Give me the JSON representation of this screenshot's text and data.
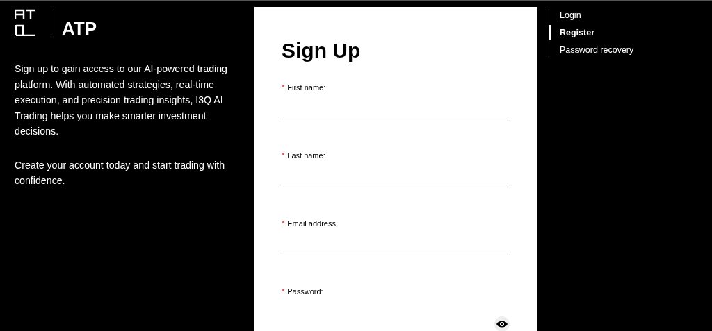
{
  "brand": {
    "name": "ATP"
  },
  "intro": [
    "Sign up to gain access to our AI-powered trading platform. With automated strategies, real-time execution, and precision trading insights, I3Q AI Trading helps you make smarter investment decisions.",
    "Create your account today and start trading with confidence."
  ],
  "form": {
    "title": "Sign Up",
    "fields": [
      {
        "kind": "text",
        "label": "First name:",
        "required_mark": "*"
      },
      {
        "kind": "text",
        "label": "Last name:",
        "required_mark": "*"
      },
      {
        "kind": "text",
        "label": "Email address:",
        "required_mark": "*"
      },
      {
        "kind": "password",
        "label": "Password:",
        "required_mark": "*"
      }
    ]
  },
  "nav": [
    {
      "label": "Login",
      "selected": false
    },
    {
      "label": "Register",
      "selected": true
    },
    {
      "label": "Password recovery",
      "selected": false
    }
  ]
}
